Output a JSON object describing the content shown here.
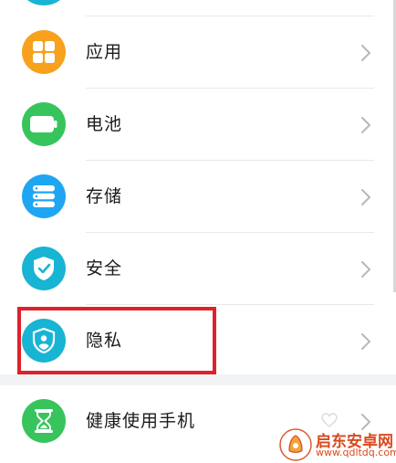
{
  "colors": {
    "apps_orange": "#f7a11c",
    "battery_green": "#38c45c",
    "storage_blue": "#1fa6f2",
    "security_teal": "#17b4d4",
    "privacy_teal": "#17b4d4",
    "health_green": "#38c45c",
    "highlight_red": "#e0202a",
    "watermark_orange": "#d94a1e"
  },
  "settings": {
    "items": [
      {
        "label": "应用",
        "icon": "grid-icon"
      },
      {
        "label": "电池",
        "icon": "battery-icon"
      },
      {
        "label": "存储",
        "icon": "storage-icon"
      },
      {
        "label": "安全",
        "icon": "shield-check-icon"
      },
      {
        "label": "隐私",
        "icon": "privacy-shield-icon"
      },
      {
        "label": "健康使用手机",
        "icon": "hourglass-icon"
      }
    ]
  },
  "watermark": {
    "title": "启东安卓网",
    "url": "www.qdltdq.com"
  }
}
